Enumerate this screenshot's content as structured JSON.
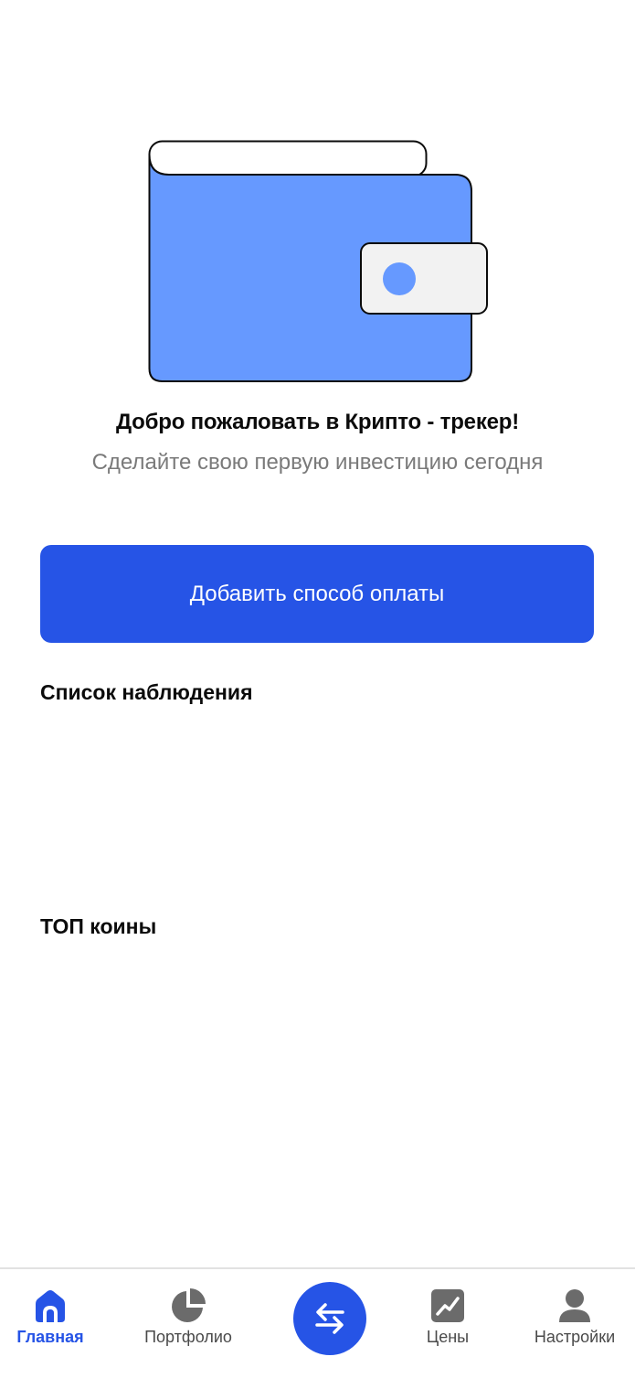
{
  "welcome": {
    "title": "Добро пожаловать в Крипто - трекер!",
    "subtitle": "Сделайте свою первую инвестицию сегодня",
    "illustration": "wallet-icon"
  },
  "actions": {
    "add_payment_label": "Добавить способ оплаты"
  },
  "sections": {
    "watchlist_title": "Список наблюдения",
    "top_coins_title": "ТОП коины"
  },
  "bottom_nav": {
    "items": [
      {
        "label": "Главная",
        "icon": "home-icon",
        "active": true
      },
      {
        "label": "Портфолио",
        "icon": "pie-chart-icon",
        "active": false
      },
      {
        "label": "",
        "icon": "swap-arrows-icon",
        "active": false
      },
      {
        "label": "Цены",
        "icon": "trend-chart-icon",
        "active": false
      },
      {
        "label": "Настройки",
        "icon": "user-icon",
        "active": false
      }
    ]
  },
  "colors": {
    "accent": "#2654e6",
    "wallet_body": "#6699ff",
    "wallet_clasp": "#f2f2f2",
    "inactive_icon": "#6b6b6b",
    "subtitle_text": "#7a7a7a"
  }
}
